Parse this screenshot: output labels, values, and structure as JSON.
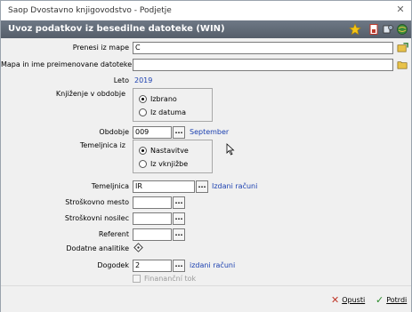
{
  "window": {
    "title": "Saop Dvostavno knjigovodstvo - Podjetje",
    "close_glyph": "✕"
  },
  "header": {
    "title": "Uvoz podatkov iz besedilne datoteke (WIN)"
  },
  "form": {
    "prenesi_label": "Prenesi iz mape",
    "prenesi_value": "C",
    "mapa_label": "Mapa in ime preimenovane datoteke",
    "mapa_value": "",
    "leto_label": "Leto",
    "leto_value": "2019",
    "knjizenje_label": "Knjiženje v obdobje",
    "knjizenje_options": [
      "Izbrano",
      "Iz datuma"
    ],
    "obdobje_label": "Obdobje",
    "obdobje_value": "009",
    "obdobje_text": "September",
    "temeljnica_iz_label": "Temeljnica iz",
    "temeljnica_iz_options": [
      "Nastavitve",
      "Iz vknjižbe"
    ],
    "temeljnica_label": "Temeljnica",
    "temeljnica_value": "IR",
    "temeljnica_text": "Izdani računi",
    "stroskovno_mesto_label": "Stroškovno mesto",
    "stroskovni_nosilec_label": "Stroškovni nosilec",
    "referent_label": "Referent",
    "dodatne_label": "Dodatne analitike",
    "dogodek_label": "Dogodek",
    "dogodek_value": "2",
    "dogodek_text": "izdani računi",
    "financni_tok_label": "Finananční tok",
    "dots": "..."
  },
  "footer": {
    "cancel_label": "Opusti",
    "confirm_label": "Potrdi"
  },
  "colors": {
    "header": "#5f6873",
    "value_blue": "#1a3fb0",
    "cancel_red": "#c0392b",
    "confirm_green": "#2a8a2a"
  }
}
